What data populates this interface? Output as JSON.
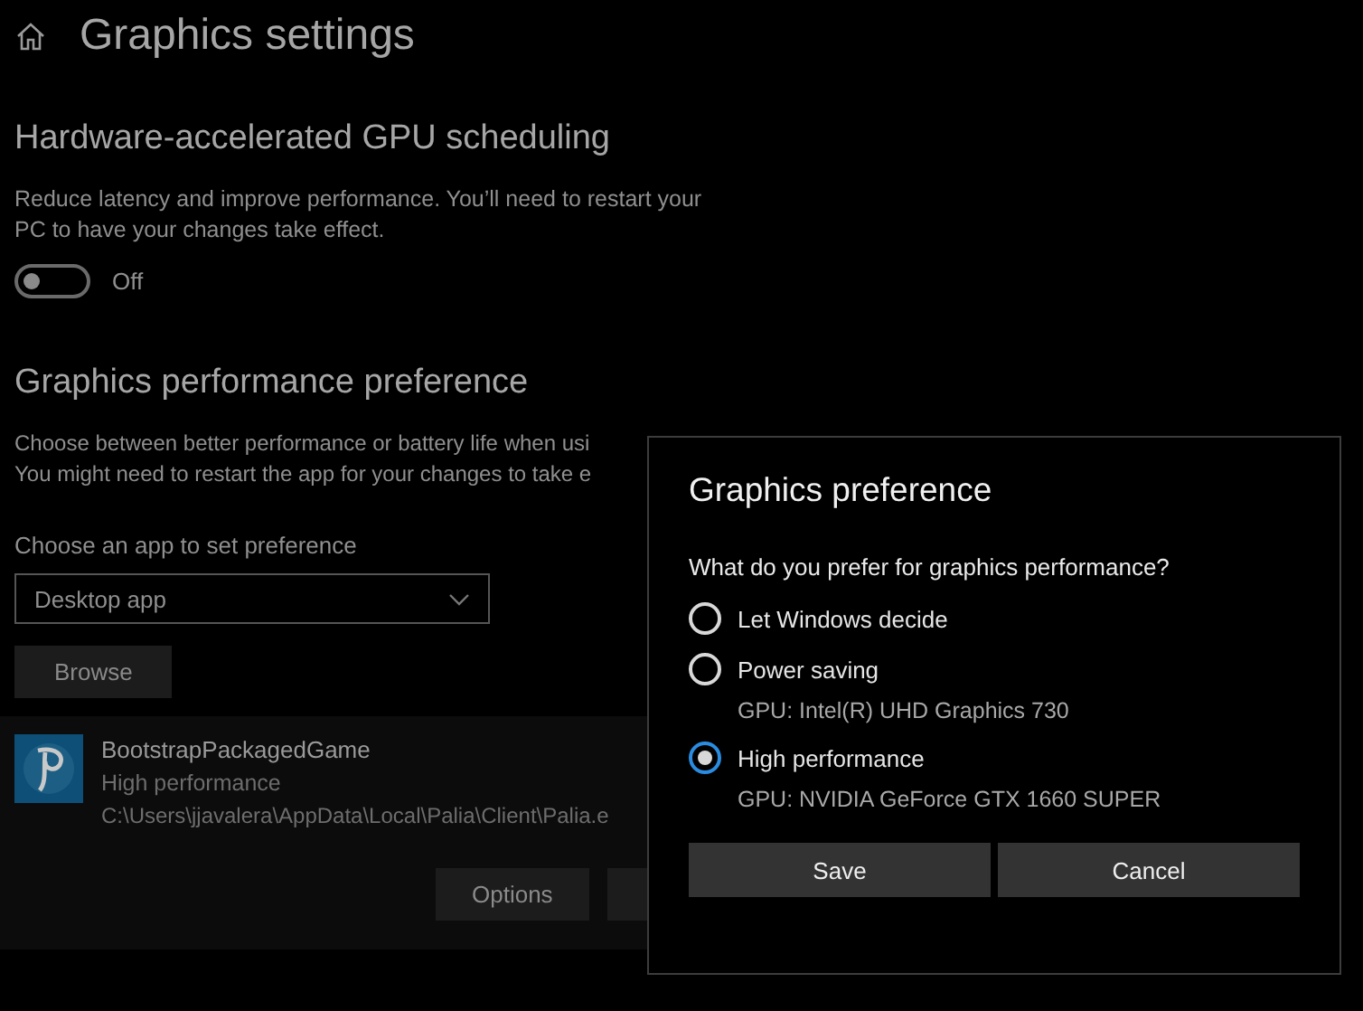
{
  "page": {
    "title": "Graphics settings"
  },
  "gpu_scheduling": {
    "heading": "Hardware-accelerated GPU scheduling",
    "description": "Reduce latency and improve performance. You’ll need to restart your PC to have your changes take effect.",
    "toggle": {
      "on": false,
      "label": "Off"
    }
  },
  "performance_preference": {
    "heading": "Graphics performance preference",
    "description_lines": [
      "Choose between better performance or battery life when usi",
      "You might need to restart the app for your changes to take e"
    ],
    "app_picker": {
      "label": "Choose an app to set preference",
      "value": "Desktop app"
    },
    "browse_button": "Browse",
    "apps": [
      {
        "name": "BootstrapPackagedGame",
        "preference": "High performance",
        "path": "C:\\Users\\jjavalera\\AppData\\Local\\Palia\\Client\\Palia.e",
        "buttons": [
          "Options"
        ]
      }
    ]
  },
  "dialog": {
    "title": "Graphics preference",
    "question": "What do you prefer for graphics performance?",
    "options": [
      {
        "label": "Let Windows decide",
        "selected": false
      },
      {
        "label": "Power saving",
        "gpu": "GPU: Intel(R) UHD Graphics 730",
        "selected": false
      },
      {
        "label": "High performance",
        "gpu": "GPU: NVIDIA GeForce GTX 1660 SUPER",
        "selected": true
      }
    ],
    "buttons": [
      "Save",
      "Cancel"
    ]
  }
}
